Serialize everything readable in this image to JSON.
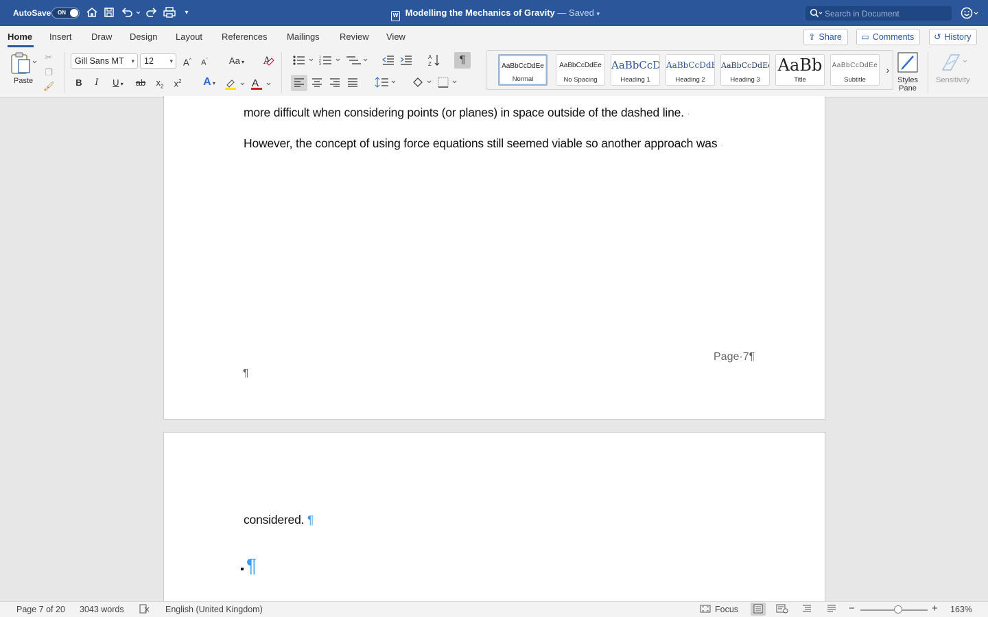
{
  "titlebar": {
    "autosave_label": "AutoSave",
    "autosave_state": "ON",
    "doc_title": "Modelling the Mechanics of Gravity",
    "saved_status": "— Saved",
    "search_placeholder": "Search in Document"
  },
  "tabs": [
    "Home",
    "Insert",
    "Draw",
    "Design",
    "Layout",
    "References",
    "Mailings",
    "Review",
    "View"
  ],
  "ribbon_buttons": {
    "share": "Share",
    "comments": "Comments",
    "history": "History"
  },
  "ribbon": {
    "paste": "Paste",
    "font_name": "Gill Sans MT",
    "font_size": "12",
    "change_case": "Aa",
    "styles_pane": "Styles Pane",
    "sensitivity": "Sensitivity"
  },
  "styles": [
    {
      "sample": "AaBbCcDdEe",
      "name": "Normal"
    },
    {
      "sample": "AaBbCcDdEe",
      "name": "No Spacing"
    },
    {
      "sample": "AaBbCcD",
      "name": "Heading 1"
    },
    {
      "sample": "AaBbCcDdE",
      "name": "Heading 2"
    },
    {
      "sample": "AaBbCcDdEe",
      "name": "Heading 3"
    },
    {
      "sample": "AaBb",
      "name": "Title"
    },
    {
      "sample": "AaBbCcDdEe",
      "name": "Subtitle"
    }
  ],
  "document": {
    "line1": "more difficult when considering points (or planes) in space outside of the dashed line.",
    "line2": "However, the concept of using force equations still seemed viable so another approach was",
    "footer": "Page·7¶",
    "pilcrow": "¶",
    "page2_line": "considered."
  },
  "statusbar": {
    "page": "Page 7 of 20",
    "words": "3043 words",
    "language": "English (United Kingdom)",
    "focus": "Focus",
    "zoom": "163%"
  },
  "colors": {
    "brand": "#2b579a",
    "formatting_mark": "#3d9bef"
  }
}
